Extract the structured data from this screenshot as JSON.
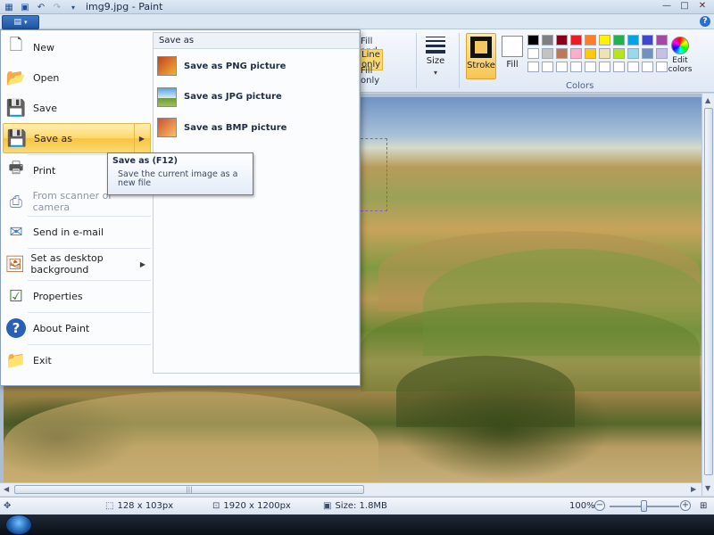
{
  "window": {
    "title": "img9.jpg - Paint",
    "controls": {
      "minimize": "—",
      "maximize": "□",
      "close": "✕"
    }
  },
  "qat": {
    "icons": [
      "save-icon",
      "undo-icon",
      "redo-icon",
      "customize-icon"
    ]
  },
  "help": {
    "label": "?"
  },
  "ribbon": {
    "shape_options": {
      "fill_and_line": "Fill and line",
      "line_only": "Line only",
      "fill_only": "Fill only"
    },
    "size_label": "Size",
    "stroke_label": "Stroke",
    "fill_label": "Fill",
    "edit_colors_label": "Edit colors",
    "colors_group_label": "Colors",
    "palette": [
      "#000000",
      "#7f7f7f",
      "#880015",
      "#ed1c24",
      "#ff7f27",
      "#fff200",
      "#22b14c",
      "#00a2e8",
      "#3f48cc",
      "#a349a4",
      "#ffffff",
      "#c3c3c3",
      "#b97a57",
      "#ffaec9",
      "#ffc90e",
      "#efe4b0",
      "#b5e61d",
      "#99d9ea",
      "#7092be",
      "#c8bfe7",
      "#ffffff",
      "#ffffff",
      "#ffffff",
      "#ffffff",
      "#ffffff",
      "#ffffff",
      "#ffffff",
      "#ffffff",
      "#ffffff",
      "#ffffff"
    ]
  },
  "app_menu": {
    "items": [
      {
        "label": "New",
        "icon": "new-file-icon"
      },
      {
        "label": "Open",
        "icon": "open-folder-icon"
      },
      {
        "label": "Save",
        "icon": "save-icon"
      },
      {
        "label": "Save as",
        "icon": "save-as-icon",
        "selected": true,
        "has_submenu": true
      },
      {
        "label": "Print",
        "icon": "printer-icon"
      },
      {
        "label": "From scanner or camera",
        "icon": "scanner-icon",
        "disabled": true
      },
      {
        "label": "Send in e-mail",
        "icon": "email-icon"
      },
      {
        "label": "Set as desktop background",
        "icon": "desktop-background-icon",
        "has_submenu": true
      },
      {
        "label": "Properties",
        "icon": "properties-icon"
      },
      {
        "label": "About Paint",
        "icon": "help-icon"
      },
      {
        "label": "Exit",
        "icon": "exit-icon"
      }
    ],
    "submenu": {
      "header": "Save as",
      "items": [
        {
          "label": "Save as PNG picture",
          "icon": "png-picture-icon"
        },
        {
          "label": "Save as JPG picture",
          "icon": "jpg-picture-icon"
        },
        {
          "label": "Save as BMP picture",
          "icon": "bmp-picture-icon"
        }
      ]
    }
  },
  "tooltip": {
    "title": "Save as (F12)",
    "body": "Save the current image as a new file"
  },
  "statusbar": {
    "selection_size": "128 x 103px",
    "image_size": "1920 x 1200px",
    "file_size": "Size: 1.8MB",
    "zoom": "100%",
    "zoom_level_fraction": 0.5
  }
}
